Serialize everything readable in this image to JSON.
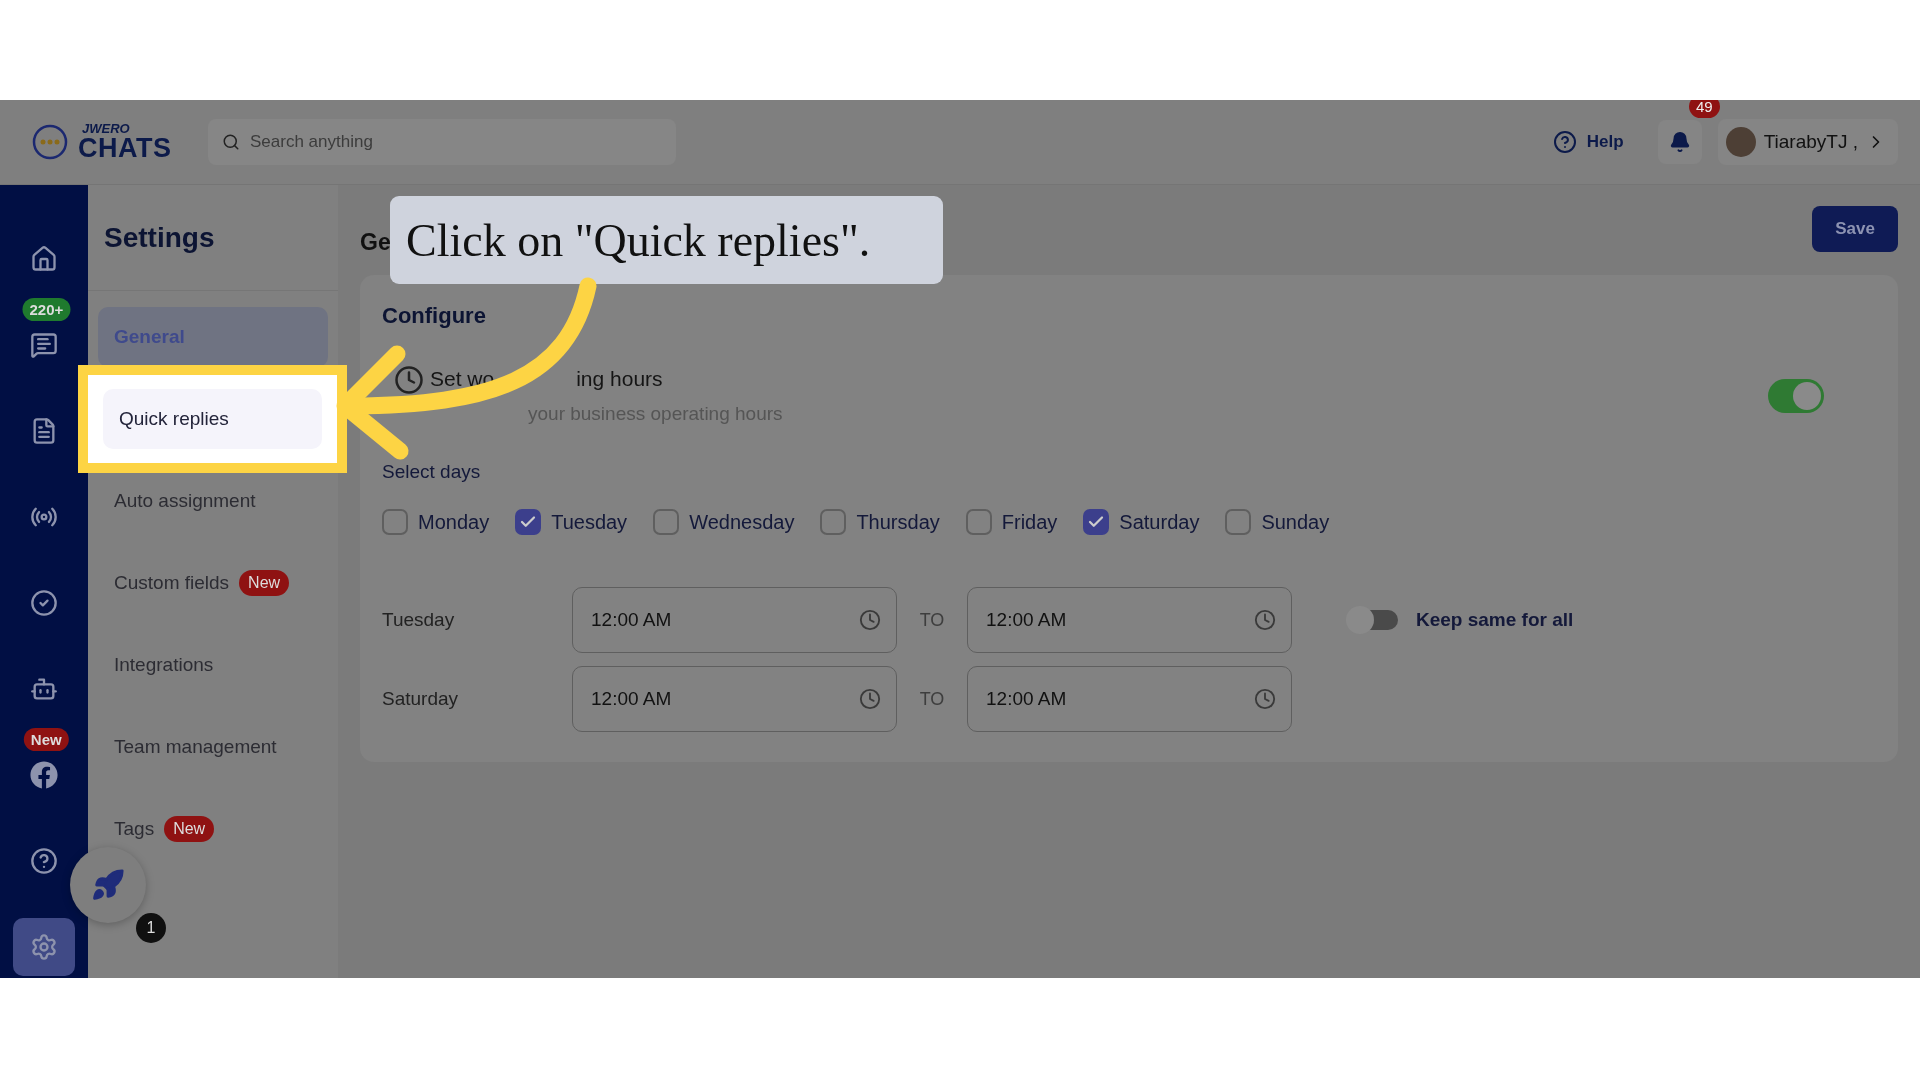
{
  "brand": {
    "top": "JWERO",
    "name": "CHATS"
  },
  "search": {
    "placeholder": "Search anything"
  },
  "topbar": {
    "help": "Help",
    "notifications": "49",
    "user": "TiarabyTJ ,"
  },
  "rail": [
    {
      "kind": "home",
      "selected": false
    },
    {
      "kind": "chats",
      "selected": false,
      "badge": "220+",
      "color": "#1f7a2e"
    },
    {
      "kind": "document",
      "selected": false
    },
    {
      "kind": "broadcast",
      "selected": false
    },
    {
      "kind": "tasks",
      "selected": false
    },
    {
      "kind": "bot",
      "selected": false
    },
    {
      "kind": "facebook",
      "selected": false,
      "badge": "New",
      "color": "#8f1212"
    },
    {
      "kind": "help",
      "selected": false
    },
    {
      "kind": "settings",
      "selected": true
    }
  ],
  "launcher": {
    "count": "1"
  },
  "settings": {
    "title": "Settings",
    "items": [
      {
        "label": "General",
        "selected": true,
        "highlighted": false
      },
      {
        "label": "Quick replies",
        "selected": false,
        "highlighted": true
      },
      {
        "label": "Auto assignment",
        "selected": false,
        "highlighted": false
      },
      {
        "label": "Custom fields",
        "selected": false,
        "highlighted": false,
        "badge": "New"
      },
      {
        "label": "Integrations",
        "selected": false,
        "highlighted": false
      },
      {
        "label": "Team management",
        "selected": false,
        "highlighted": false
      },
      {
        "label": "Tags",
        "selected": false,
        "highlighted": false,
        "badge": "New"
      }
    ]
  },
  "page": {
    "heading": "Ge",
    "save": "Save"
  },
  "card": {
    "title": "Configure",
    "hours_title": [
      "Set wo",
      "ing hours"
    ],
    "hours_subtitle": "your business operating hours",
    "hours_on": true,
    "days_label": "Select days",
    "days": [
      {
        "label": "Monday",
        "checked": false
      },
      {
        "label": "Tuesday",
        "checked": true
      },
      {
        "label": "Wednesday",
        "checked": false
      },
      {
        "label": "Thursday",
        "checked": false
      },
      {
        "label": "Friday",
        "checked": false
      },
      {
        "label": "Saturday",
        "checked": true
      },
      {
        "label": "Sunday",
        "checked": false
      }
    ],
    "schedule": [
      {
        "day": "Tuesday",
        "from": "12:00 AM",
        "to_label": "TO",
        "to": "12:00 AM"
      },
      {
        "day": "Saturday",
        "from": "12:00 AM",
        "to_label": "TO",
        "to": "12:00 AM"
      }
    ],
    "keep_same": {
      "label": "Keep same for all",
      "on": false
    }
  },
  "tutorial": {
    "callout": "Click on \"Quick replies\"."
  }
}
